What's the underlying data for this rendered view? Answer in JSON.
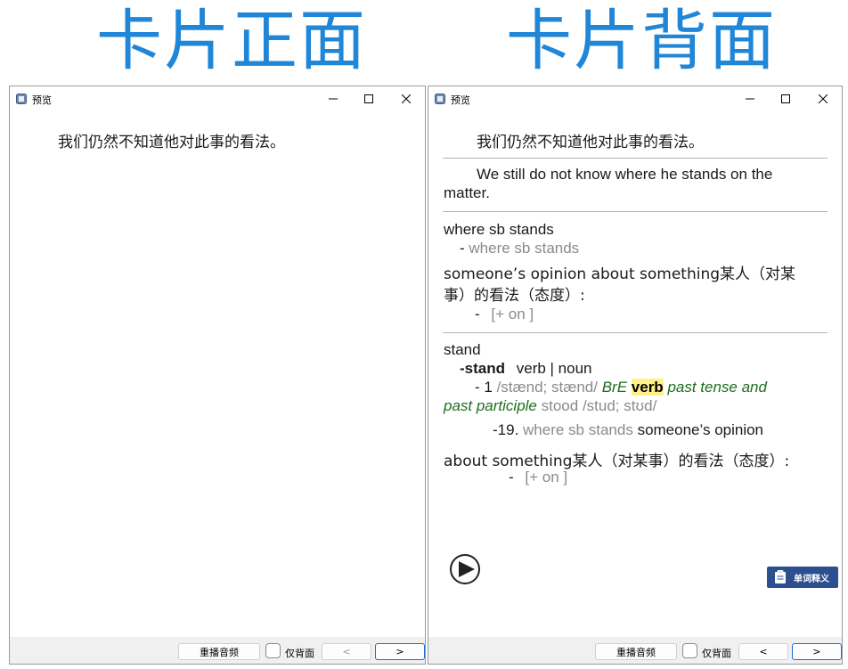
{
  "headings": {
    "front": "卡片正面",
    "back": "卡片背面"
  },
  "window": {
    "title": "预览",
    "minimize_symbol": "−",
    "maximize_symbol": "☐",
    "close_symbol": "✕"
  },
  "front": {
    "sentence_zh": "我们仍然不知道他对此事的看法。"
  },
  "back": {
    "sentence_zh": "我们仍然不知道他对此事的看法。",
    "sentence_en_line1": "We still do not know where he stands on the",
    "sentence_en_line2": "matter.",
    "phrase": {
      "headword": "where sb stands",
      "example_prefix": "- ",
      "example": "where sb stands",
      "definition_line1": "someone’s opinion about something某人（对某",
      "definition_line2": "事）的看法（态度）:",
      "note_prefix": "-",
      "note": "[+ on ]"
    },
    "word": {
      "headword": "stand",
      "pos_prefix": "-",
      "bold_word": "stand",
      "pos": "verb | noun",
      "sense_prefix": "- 1",
      "pron": "/stænd; stænd/",
      "bre": "BrE",
      "verb_label": "verb",
      "past_tense": "past tense and",
      "past_participle": "past participle",
      "stood": "stood",
      "stood_pron": "/stud; stʊd/",
      "sense_num": "-19.",
      "sense_phrase": "where sb stands",
      "sense_def1": "someone’s opinion",
      "sense_def2": "about something某人（对某事）的看法（态度）:",
      "note_prefix": "-",
      "note": "[+ on ]"
    },
    "definition_button": "单词释义"
  },
  "footer": {
    "replay": "重播音频",
    "back_only": "仅背面",
    "prev": "<",
    "next": ">"
  },
  "colors": {
    "heading": "#1f86d8",
    "accent": "#2c4f8f",
    "highlight": "#fff08a",
    "green": "#1c6e1c"
  }
}
